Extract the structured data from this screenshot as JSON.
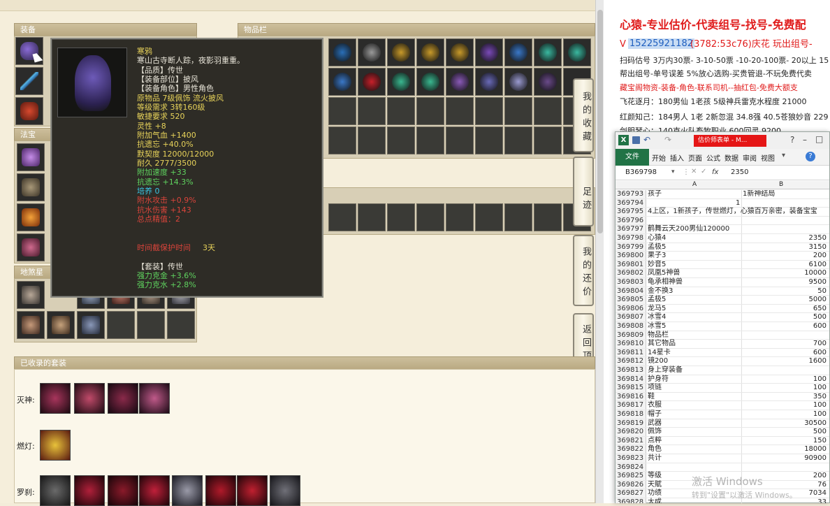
{
  "game": {
    "equip_header": "装备",
    "fabao_header": "法宝",
    "inventory_header": "物品栏",
    "suit_header": "已收录的套装",
    "beast_header": "地煞星",
    "suits": [
      {
        "name": "灭神:"
      },
      {
        "name": "燃灯:"
      },
      {
        "name": "罗刹:"
      }
    ],
    "side_buttons": [
      "我的收藏",
      "足迹",
      "我的还价",
      "返回顶部"
    ],
    "tooltip": {
      "name": "寒鸦",
      "desc": "寒山古寺断人踪，夜影羽重重。",
      "quality": "【品质】传世",
      "part": "【装备部位】披风",
      "role": "【装备角色】男性角色",
      "origin": "原物品 7级佩饰 流火披风",
      "level": "等级需求 3转160级",
      "agility": "敏捷要求 520",
      "spirit": "灵性 +8",
      "hp": "附加气血 +1400",
      "resist_forget": "抗遗忘 +40.0%",
      "tacit": "默契度 12000/12000",
      "durability": "耐久 2777/3500",
      "speed": "附加速度 +33",
      "resist_forget2": "抗遗忘 +14.3%",
      "nurture": "培养 0",
      "water_atk": "附水攻击 +0.9%",
      "water_dmg": "抗水伤害 +143",
      "refine": "总点精值：2",
      "protect_label": "时间截保护时间",
      "protect_value": "3天",
      "set_label": "【套装】传世",
      "set1": "强力克金 +3.6%",
      "set2": "强力克水 +2.8%"
    }
  },
  "right_panel": {
    "title": "心猿-专业估价-代卖组号-找号-免费配",
    "phone_prefix": "V",
    "phone": "15225921182",
    "phone_rest": "(3782:53c76)庆花 玩出组号-",
    "lines": [
      "扫码估号 3万内30票- 3-10-50票  -10-20-100票- 20以上 15",
      "帮出组号-单号误差 5%放心选购-买贵管退-不玩免费代卖",
      "藏宝阁物资-装备-角色-联系司机--抽红包-免费大额支",
      "飞花逐月：180男仙 1老孩 5级神兵雷克水程度 21000",
      "红颜知己：184男人 1老 2新忽混 34.8强 40.5苍狼妙音 229",
      "剑胆琴心：140克火队畜牧职业 600回灵 9200"
    ]
  },
  "excel": {
    "window_title": "估价师表单 - M...",
    "tabs": [
      "文件",
      "开始",
      "插入",
      "页面",
      "公式",
      "数据",
      "审阅",
      "视图"
    ],
    "cell_ref": "B369798",
    "formula_value": "2350",
    "col_a": "A",
    "col_b": "B",
    "rows": [
      {
        "n": "369793",
        "a": "孩子",
        "b": "1新神结局",
        "b_left": true
      },
      {
        "n": "369794",
        "a": "",
        "b": "1",
        "b_left": false,
        "mid": true
      },
      {
        "n": "369795",
        "a": "4上区，1新孩子，传世燃灯，心猿百万亲密，装备宝宝",
        "b": "",
        "b_left": true
      },
      {
        "n": "369796",
        "a": "",
        "b": ""
      },
      {
        "n": "369797",
        "a": "鹤舞云天200男仙120000",
        "b": ""
      },
      {
        "n": "369798",
        "a": "心猿4",
        "b": "2350"
      },
      {
        "n": "369799",
        "a": "孟极5",
        "b": "3150"
      },
      {
        "n": "369800",
        "a": "果子3",
        "b": "200"
      },
      {
        "n": "369801",
        "a": "妙音5",
        "b": "6100"
      },
      {
        "n": "369802",
        "a": "凤凰5神兽",
        "b": "10000"
      },
      {
        "n": "369803",
        "a": "龟承相神兽",
        "b": "9500"
      },
      {
        "n": "369804",
        "a": "金不换3",
        "b": "50"
      },
      {
        "n": "369805",
        "a": "孟极5",
        "b": "5000"
      },
      {
        "n": "369806",
        "a": "龙马5",
        "b": "650"
      },
      {
        "n": "369807",
        "a": "冰雪4",
        "b": "500"
      },
      {
        "n": "369808",
        "a": "冰雪5",
        "b": "600"
      },
      {
        "n": "369809",
        "a": "物品栏",
        "b": ""
      },
      {
        "n": "369810",
        "a": "其它物品",
        "b": "700"
      },
      {
        "n": "369811",
        "a": "14星卡",
        "b": "600"
      },
      {
        "n": "369812",
        "a": "镜200",
        "b": "1600"
      },
      {
        "n": "369813",
        "a": "身上穿装备",
        "b": ""
      },
      {
        "n": "369814",
        "a": "护身符",
        "b": "100"
      },
      {
        "n": "369815",
        "a": "项链",
        "b": "100"
      },
      {
        "n": "369816",
        "a": "鞋",
        "b": "350"
      },
      {
        "n": "369817",
        "a": "衣服",
        "b": "100"
      },
      {
        "n": "369818",
        "a": "帽子",
        "b": "100"
      },
      {
        "n": "369819",
        "a": "武器",
        "b": "30500"
      },
      {
        "n": "369820",
        "a": "佩饰",
        "b": "500"
      },
      {
        "n": "369821",
        "a": "点粹",
        "b": "150"
      },
      {
        "n": "369822",
        "a": "角色",
        "b": "18000"
      },
      {
        "n": "369823",
        "a": "共计",
        "b": "90900"
      },
      {
        "n": "369824",
        "a": "",
        "b": ""
      },
      {
        "n": "369825",
        "a": "等级",
        "b": "200"
      },
      {
        "n": "369826",
        "a": "天賦",
        "b": "76"
      },
      {
        "n": "369827",
        "a": "功绩",
        "b": "7034"
      },
      {
        "n": "369828",
        "a": "大成",
        "b": "33"
      }
    ]
  },
  "watermark": {
    "line1": "激活 Windows",
    "line2": "转到\"设置\"以激活 Windows。"
  },
  "colors": {
    "tooltip_gold": "#e8d35a",
    "tooltip_green": "#5fd35f",
    "tooltip_red": "#d9443b",
    "tooltip_cyan": "#39c7e6",
    "right_red": "#e01b1b",
    "right_blue": "#1f5fbf",
    "excel_green": "#217346"
  }
}
